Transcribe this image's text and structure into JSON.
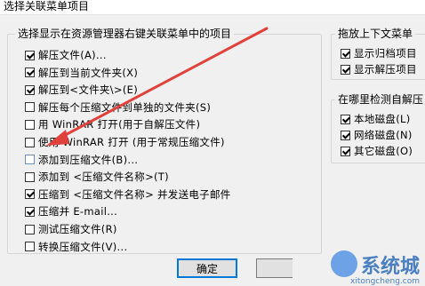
{
  "window": {
    "title": "选择关联菜单项目"
  },
  "group_main": {
    "title": "选择显示在资源管理器右键关联菜单中的项目",
    "items": [
      {
        "label": "解压文件(A)...",
        "checked": true
      },
      {
        "label": "解压到当前文件夹(X)",
        "checked": true
      },
      {
        "label": "解压到<文件夹\\>(E)",
        "checked": true
      },
      {
        "label": "解压每个压缩文件到单独的文件夹(S)",
        "checked": false
      },
      {
        "label": "用 WinRAR 打开(用于自解压文件)",
        "checked": false
      },
      {
        "label": "使用 WinRAR 打开 (用于常规压缩文件)",
        "checked": false
      },
      {
        "label": "添加到压缩文件(B)...",
        "checked": false
      },
      {
        "label": "添加到 <压缩文件名称>(T)",
        "checked": false
      },
      {
        "label": "压缩到 <压缩文件名称> 并发送电子邮件",
        "checked": true
      },
      {
        "label": "压缩并 E-mail...",
        "checked": true
      },
      {
        "label": "测试压缩文件(R)",
        "checked": false
      },
      {
        "label": "转换压缩文件(V)...",
        "checked": false
      }
    ]
  },
  "group_drag": {
    "title": "拖放上下文菜单",
    "items": [
      {
        "label": "显示归档项目",
        "checked": true
      },
      {
        "label": "显示解压项目",
        "checked": true
      }
    ]
  },
  "group_detect": {
    "title": "在哪里检测自解压",
    "items": [
      {
        "label": "本地磁盘(L)",
        "checked": true
      },
      {
        "label": "网络磁盘(N)",
        "checked": true
      },
      {
        "label": "其它磁盘(O)",
        "checked": true
      }
    ]
  },
  "buttons": {
    "ok": "确定"
  },
  "watermark": {
    "brand": "系统城",
    "url": "xitongcheng.com"
  },
  "colors": {
    "arrow": "#e0413a",
    "accent": "#0078d7"
  }
}
